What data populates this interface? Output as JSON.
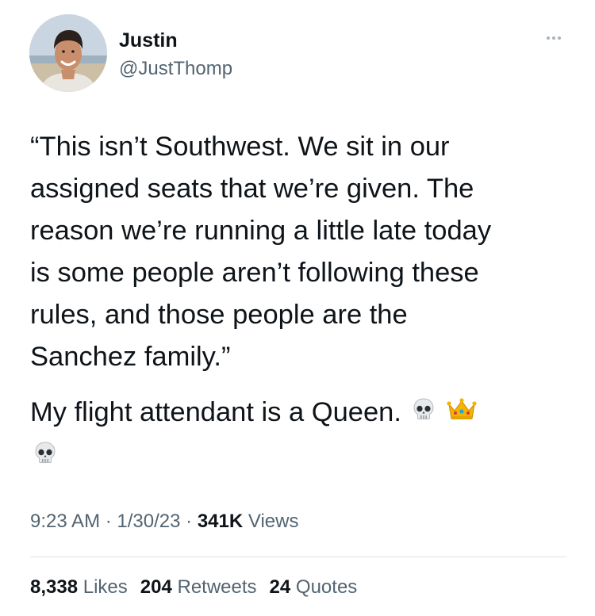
{
  "author": {
    "name": "Justin",
    "handle": "@JustThomp"
  },
  "tweet": {
    "quote_lines": [
      "“This isn’t Southwest. We sit in our",
      "assigned seats that we’re given. The",
      "reason we’re running a little late today",
      "is some people aren’t following these",
      "rules, and those people are the",
      "Sanchez family.”"
    ],
    "comment": "My flight attendant is a Queen.",
    "emojis": [
      "skull-emoji",
      "crown-emoji",
      "skull-emoji"
    ]
  },
  "meta": {
    "time": "9:23 AM",
    "separator": "·",
    "date": "1/30/23",
    "views_count": "341K",
    "views_label": "Views"
  },
  "stats": {
    "likes_count": "8,338",
    "likes_label": "Likes",
    "retweets_count": "204",
    "retweets_label": "Retweets",
    "quotes_count": "24",
    "quotes_label": "Quotes"
  },
  "icons": {
    "more": "more-icon"
  }
}
